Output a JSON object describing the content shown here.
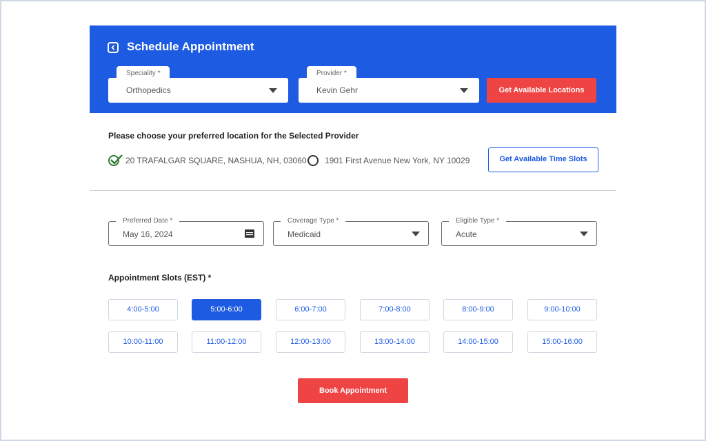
{
  "header": {
    "title": "Schedule Appointment",
    "speciality": {
      "label": "Speciality *",
      "value": "Orthopedics"
    },
    "provider": {
      "label": "Provider *",
      "value": "Kevin Gehr"
    },
    "locations_button": "Get Available Locations"
  },
  "locations": {
    "prompt": "Please choose your preferred location for the Selected Provider",
    "options": [
      {
        "label": "20 TRAFALGAR SQUARE, NASHUA, NH, 03060",
        "selected": true
      },
      {
        "label": "1901 First Avenue New York, NY 10029",
        "selected": false
      }
    ],
    "time_slots_button": "Get Available Time Slots"
  },
  "filters": {
    "date": {
      "label": "Preferred Date *",
      "value": "May 16, 2024"
    },
    "coverage": {
      "label": "Coverage Type *",
      "value": "Medicaid"
    },
    "eligible": {
      "label": "Eligible Type *",
      "value": "Acute"
    }
  },
  "slots": {
    "title": "Appointment Slots (EST) *",
    "items": [
      {
        "label": "4:00-5:00",
        "selected": false
      },
      {
        "label": "5:00-6:00",
        "selected": true
      },
      {
        "label": "6:00-7:00",
        "selected": false
      },
      {
        "label": "7:00-8:00",
        "selected": false
      },
      {
        "label": "8:00-9:00",
        "selected": false
      },
      {
        "label": "9:00-10:00",
        "selected": false
      },
      {
        "label": "10:00-11:00",
        "selected": false
      },
      {
        "label": "11:00-12:00",
        "selected": false
      },
      {
        "label": "12:00-13:00",
        "selected": false
      },
      {
        "label": "13:00-14:00",
        "selected": false
      },
      {
        "label": "14:00-15:00",
        "selected": false
      },
      {
        "label": "15:00-16:00",
        "selected": false
      }
    ]
  },
  "book_button": "Book Appointment",
  "icons": {
    "back": "chevron-left-icon",
    "calendar": "calendar-icon",
    "dropdown": "caret-down-icon",
    "check": "check-icon"
  },
  "colors": {
    "primary": "#1e5be3",
    "danger": "#ef4444",
    "success": "#2e7d32"
  }
}
